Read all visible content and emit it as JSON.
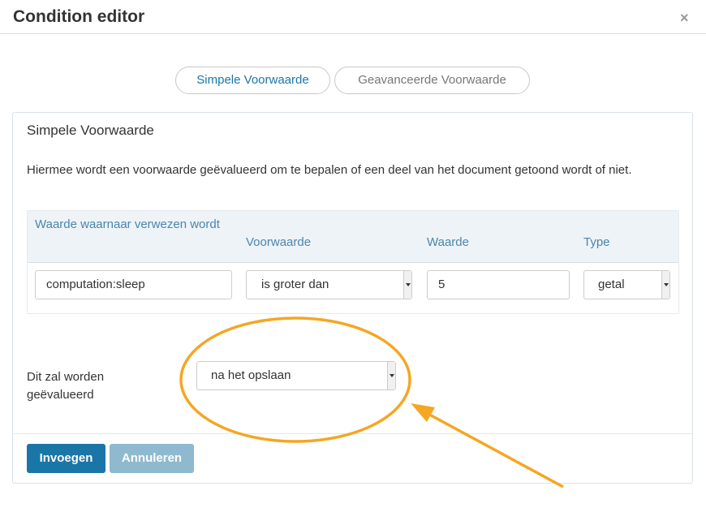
{
  "dialog": {
    "title": "Condition editor",
    "close_glyph": "×"
  },
  "tabs": [
    {
      "label": "Simpele Voorwaarde",
      "active": true
    },
    {
      "label": "Geavanceerde Voorwaarde",
      "active": false
    }
  ],
  "panel": {
    "title": "Simpele Voorwaarde",
    "description": "Hiermee wordt een voorwaarde geëvalueerd om te bepalen of een deel van het document getoond wordt of niet."
  },
  "table": {
    "headers": [
      "Waarde waarnaar verwezen wordt",
      "Voorwaarde",
      "Waarde",
      "Type"
    ],
    "row": {
      "reference": "computation:sleep",
      "condition": "is groter dan",
      "value": "5",
      "type": "getal"
    }
  },
  "evaluation": {
    "label": "Dit zal worden geëvalueerd",
    "selected": "na het opslaan"
  },
  "buttons": {
    "insert": "Invoegen",
    "cancel": "Annuleren"
  },
  "colors": {
    "accent": "#1b76a8",
    "annotation": "#f5a623",
    "header_bg": "#eef3f7",
    "disabled_button": "#8fb9cf"
  },
  "icons": {
    "close": "close-icon",
    "dropdown": "chevron-down-icon"
  }
}
